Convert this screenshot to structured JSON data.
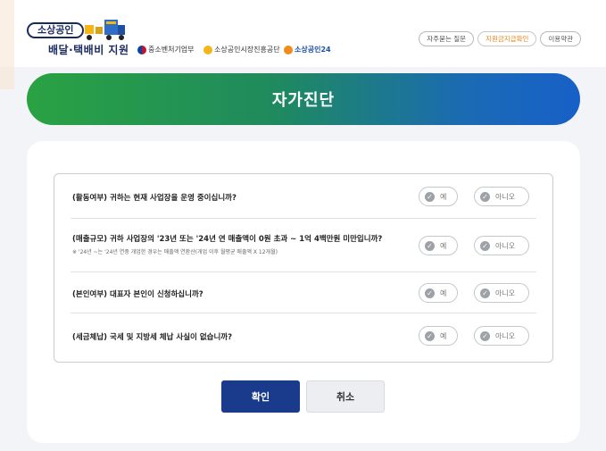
{
  "header": {
    "badge_text": "소상공인",
    "title": "배달·택배비 지원",
    "orgs": [
      "중소벤처기업부",
      "소상공인시장진흥공단",
      "소상공인24"
    ],
    "nav": [
      "자주묻는 질문",
      "지원금지급확인",
      "이용약관"
    ]
  },
  "banner": {
    "title": "자가진단"
  },
  "questions": [
    {
      "text": "(활동여부) 귀하는 현재 사업장을 운영 중이십니까?",
      "note": ""
    },
    {
      "text": "(매출규모) 귀하 사업장의 '23년 또는 '24년 연 매출액이 0원 초과 ~ 1억 4백만원 미만입니까?",
      "note": "※ '24년 ~는 '24년 연중 개업한 경우는 매출액 연환산(개업 이후 월평균 매출액 X 12개월)"
    },
    {
      "text": "(본인여부) 대표자 본인이 신청하십니까?",
      "note": ""
    },
    {
      "text": "(세금체납) 국세 및 지방세 체납 사실이 없습니까?",
      "note": ""
    }
  ],
  "options": {
    "yes": "예",
    "no": "아니오",
    "check_icon": "check-circle-icon"
  },
  "buttons": {
    "confirm": "확인",
    "cancel": "취소"
  },
  "colors": {
    "banner_start": "#2aa243",
    "banner_end": "#1760c8",
    "confirm_bg": "#1a3b8c",
    "active_nav": "#e8841b"
  }
}
